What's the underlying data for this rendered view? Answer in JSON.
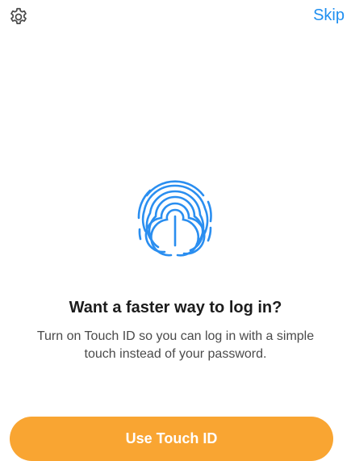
{
  "toolbar": {
    "settings_icon": "gear-icon",
    "skip_label": "Skip"
  },
  "prompt": {
    "icon": "fingerprint-icon",
    "headline": "Want a faster way to log in?",
    "description": "Turn on Touch ID so you can log in with a simple touch instead of your password."
  },
  "actions": {
    "use_touch_id_label": "Use Touch ID"
  },
  "colors": {
    "accent": "#1f8ff0",
    "primary_button": "#f9a532",
    "fingerprint": "#2a8ef0"
  }
}
